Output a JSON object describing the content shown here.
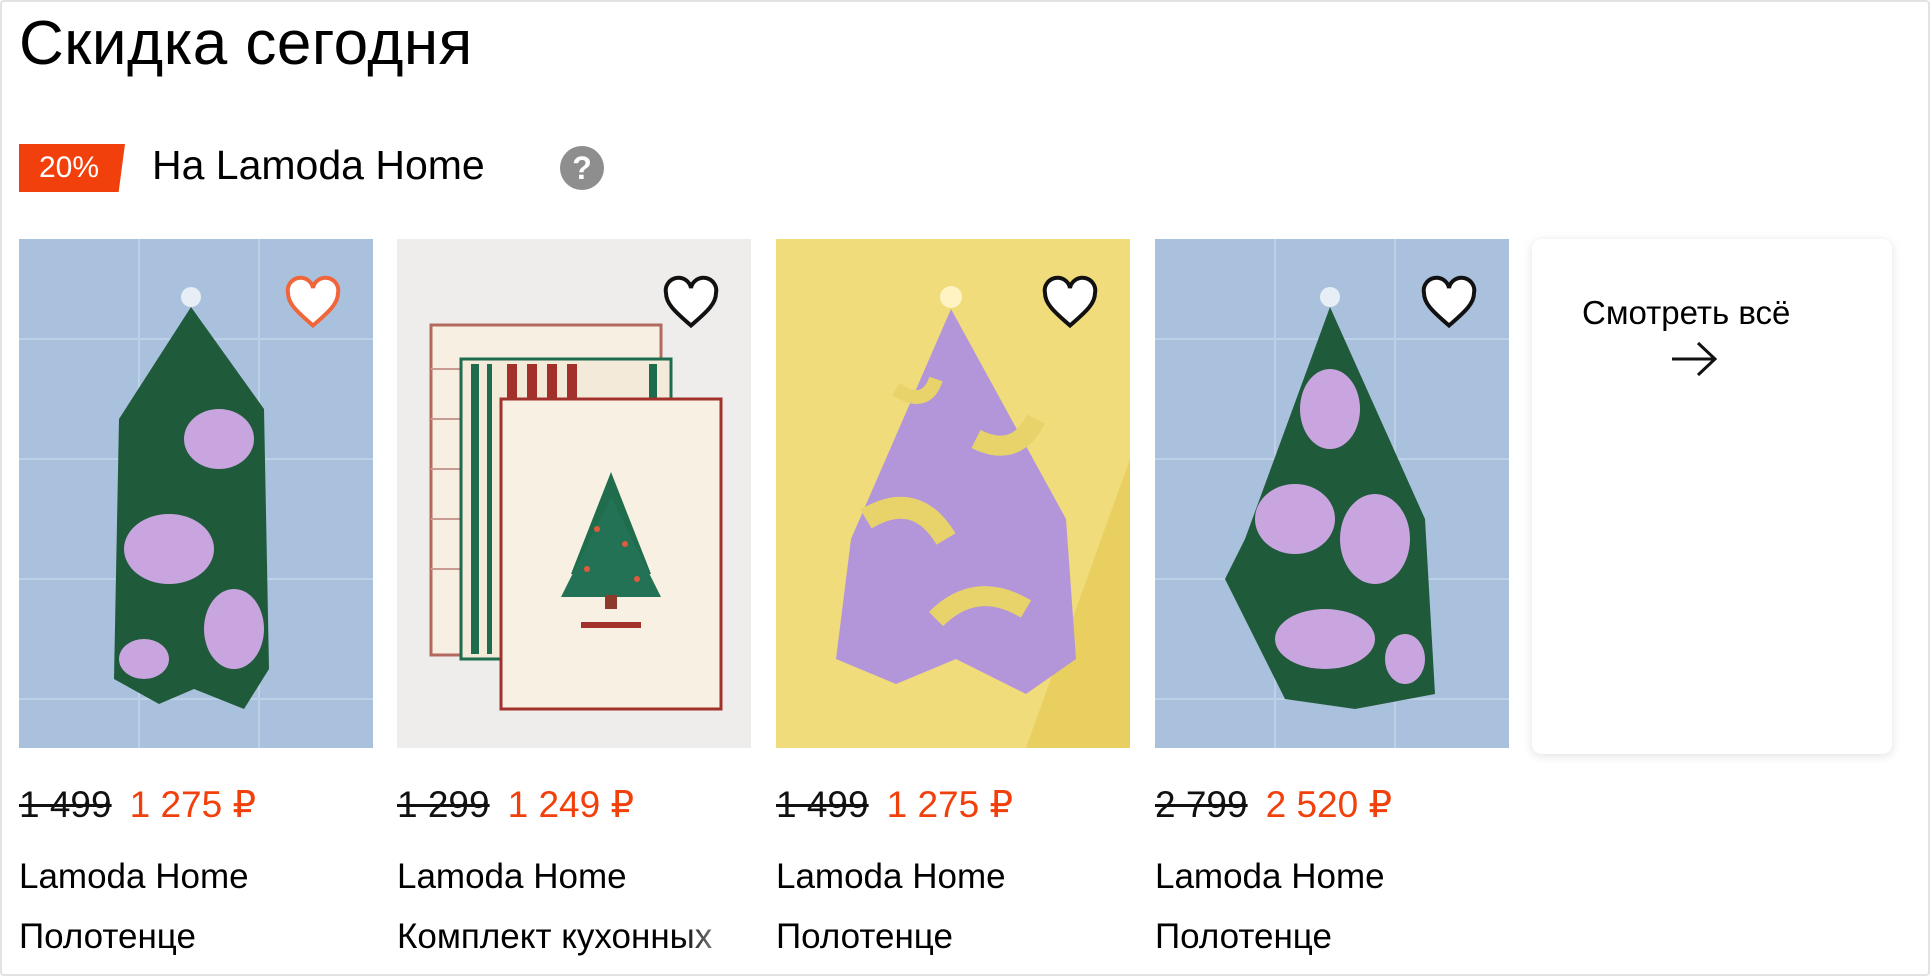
{
  "section": {
    "title": "Скидка сегодня",
    "badge": "20%",
    "promo_label": "На Lamoda Home",
    "help_icon": "question-icon"
  },
  "products": [
    {
      "old_price": "1 499",
      "new_price": "1 275 ₽",
      "brand": "Lamoda Home",
      "name": "Полотенце",
      "favorite": true
    },
    {
      "old_price": "1 299",
      "new_price": "1 249 ₽",
      "brand": "Lamoda Home",
      "name": "Комплект кухонных",
      "favorite": false
    },
    {
      "old_price": "1 499",
      "new_price": "1 275 ₽",
      "brand": "Lamoda Home",
      "name": "Полотенце",
      "favorite": false
    },
    {
      "old_price": "2 799",
      "new_price": "2 520 ₽",
      "brand": "Lamoda Home",
      "name": "Полотенце",
      "favorite": false
    }
  ],
  "see_all": {
    "label": "Смотреть всё",
    "icon": "arrow-right-icon"
  },
  "colors": {
    "accent": "#f1400c",
    "help_gray": "#8e8e8e"
  }
}
